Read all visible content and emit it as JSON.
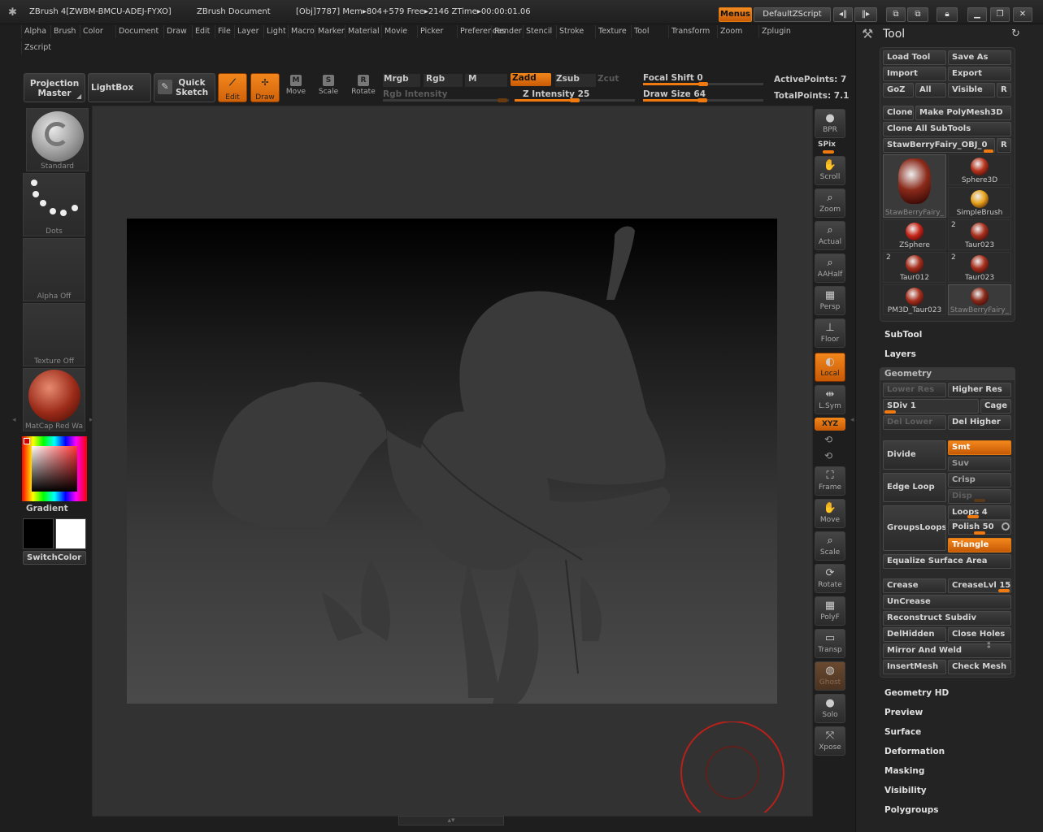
{
  "titlebar": {
    "app": "ZBrush 4[ZWBM-BMCU-ADEJ-FYXO]",
    "doc": "ZBrush Document",
    "stats": "[Obj]7787] Mem▸804+579  Free▸2146  ZTime▸00:00:01.06",
    "menus_button": "Menus",
    "script_button": "DefaultZScript"
  },
  "menubar": {
    "items": [
      "Alpha",
      "Brush",
      "Color",
      "Document",
      "Draw",
      "Edit",
      "File",
      "Layer",
      "Light",
      "Macro",
      "Marker",
      "Material",
      "Movie",
      "Picker",
      "Preferences",
      "Render",
      "Stencil",
      "Stroke",
      "Texture",
      "Tool",
      "Transform",
      "Zoom",
      "Zplugin"
    ],
    "row2": [
      "Zscript"
    ]
  },
  "shelf": {
    "projection_master": "Projection Master",
    "lightbox": "LightBox",
    "quick_sketch": "Quick Sketch",
    "edit": "Edit",
    "draw": "Draw",
    "move": "Move",
    "scale": "Scale",
    "rotate": "Rotate",
    "mrgb": "Mrgb",
    "rgb": "Rgb",
    "m": "M",
    "rgb_intensity": "Rgb  Intensity",
    "zadd": "Zadd",
    "zsub": "Zsub",
    "zcut": "Zcut",
    "z_intensity": "Z  Intensity 25",
    "focal_shift": "Focal  Shift 0",
    "draw_size": "Draw  Size 64",
    "active_points": "ActivePoints: 7",
    "total_points": "TotalPoints: 7.1"
  },
  "left": {
    "brush": "Standard",
    "stroke": "Dots",
    "alpha": "Alpha  Off",
    "texture": "Texture  Off",
    "material": "MatCap  Red  Wa",
    "gradient": "Gradient",
    "switch_color": "SwitchColor"
  },
  "right_tools": {
    "bpr": "BPR",
    "spix": "SPix",
    "scroll": "Scroll",
    "zoom": "Zoom",
    "actual": "Actual",
    "aahalf": "AAHalf",
    "persp": "Persp",
    "floor": "Floor",
    "local": "Local",
    "lsym": "L.Sym",
    "xyz": "XYZ",
    "frame": "Frame",
    "move": "Move",
    "scale": "Scale",
    "rotate": "Rotate",
    "polyf": "PolyF",
    "transp": "Transp",
    "ghost": "Ghost",
    "solo": "Solo",
    "xpose": "Xpose"
  },
  "tool_panel": {
    "title": "Tool",
    "load_tool": "Load Tool",
    "save_as": "Save As",
    "import": "Import",
    "export": "Export",
    "goz": "GoZ",
    "all": "All",
    "visible": "Visible",
    "r": "R",
    "clone": "Clone",
    "make_polymesh": "Make PolyMesh3D",
    "clone_all": "Clone  All  SubTools",
    "current_tool": "StawBerryFairy_OBJ_0",
    "thumbs": [
      {
        "label": "StawBerryFairy_",
        "color": "#8a2a1a"
      },
      {
        "label": "Sphere3D",
        "color": "#b8341e"
      },
      {
        "label": "SimpleBrush",
        "color": "#e8a21a"
      },
      {
        "label": "ZSphere",
        "color": "#c8261a"
      },
      {
        "label": "Taur023",
        "color": "#a8301e"
      },
      {
        "label": "Taur012",
        "color": "#a8301e"
      },
      {
        "label": "Taur023",
        "color": "#a8301e"
      },
      {
        "label": "PM3D_Taur023",
        "color": "#a8301e"
      },
      {
        "label": "StawBerryFairy_",
        "color": "#8a2a1a"
      }
    ],
    "thumb_badge": "2",
    "subtool": "SubTool",
    "layers": "Layers",
    "geometry": "Geometry",
    "lower_res": "Lower  Res",
    "higher_res": "Higher  Res",
    "sdiv": "SDiv 1",
    "cage": "Cage",
    "del_lower": "Del  Lower",
    "del_higher": "Del  Higher",
    "divide": "Divide",
    "smt": "Smt",
    "suv": "Suv",
    "edge_loop": "Edge  Loop",
    "crisp": "Crisp",
    "disp": "Disp",
    "groups_loops": "GroupsLoops",
    "loops": "Loops 4",
    "polish": "Polish 50",
    "triangle": "Triangle",
    "equalize": "Equalize  Surface  Area",
    "crease": "Crease",
    "crease_lvl": "CreaseLvl 15",
    "uncrease": "UnCrease",
    "reconstruct": "Reconstruct  Subdiv",
    "delhidden": "DelHidden",
    "close_holes": "Close  Holes",
    "mirror_weld": "Mirror  And  Weld",
    "insertmesh": "InsertMesh",
    "check_mesh": "Check  Mesh",
    "sections": [
      "Geometry HD",
      "Preview",
      "Surface",
      "Deformation",
      "Masking",
      "Visibility",
      "Polygroups"
    ]
  },
  "colors": {
    "accent": "#f07a10",
    "panel": "#232323",
    "canvas": "#323232"
  }
}
